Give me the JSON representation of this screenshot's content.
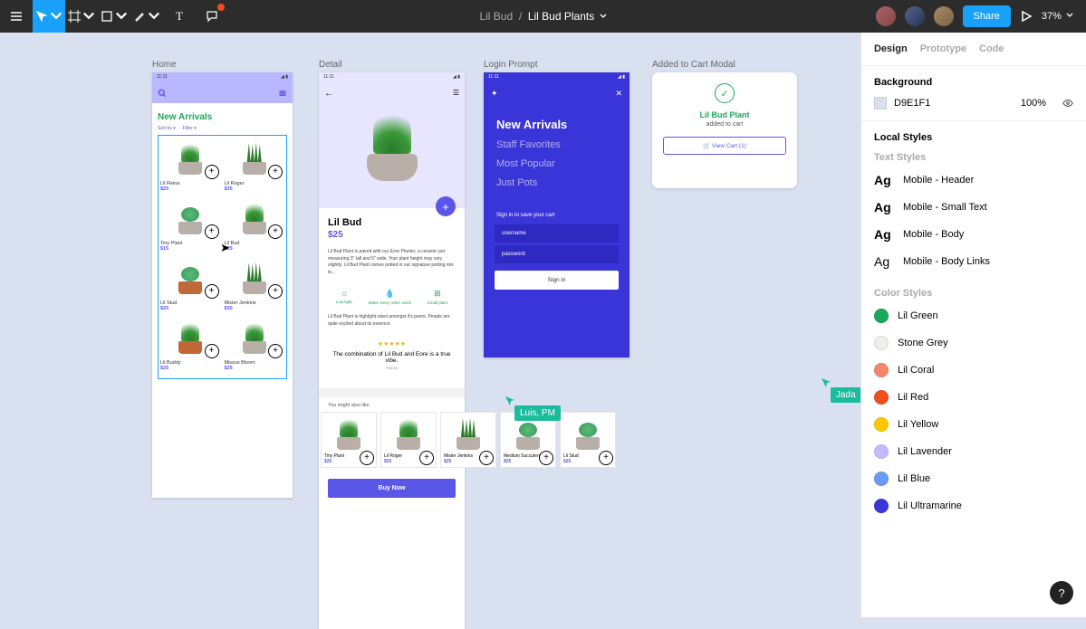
{
  "toolbar": {
    "title_prefix": "Lil Bud",
    "title": "Lil Bud Plants",
    "share_label": "Share",
    "zoom": "37%"
  },
  "frames": {
    "home": {
      "label": "Home",
      "time": "11:11",
      "section_title": "New Arrivals",
      "sort": "Sort by",
      "filter": "Filter",
      "products": [
        {
          "name": "Lil Reina",
          "price": "$25"
        },
        {
          "name": "Lil Roger",
          "price": "$35"
        },
        {
          "name": "Tiny Plant",
          "price": "$15"
        },
        {
          "name": "Lil Bud",
          "price": "$25"
        },
        {
          "name": "Lil Stud",
          "price": "$25"
        },
        {
          "name": "Mister Jenkins",
          "price": "$30"
        },
        {
          "name": "Lil Buddy",
          "price": "$25"
        },
        {
          "name": "Missus Bloom",
          "price": "$25"
        }
      ]
    },
    "detail": {
      "label": "Detail",
      "time": "11:11",
      "title": "Lil Bud",
      "price": "$25",
      "description": "Lil Bud Plant is paired with our Eore Planter, a ceramic pot measuring 3\" tall and 5\" wide. Your plant height may vary slightly. Lil Bud Plant comes potted in our signature potting mix to...",
      "stats": [
        {
          "icon": "☼",
          "label": "Low light"
        },
        {
          "icon": "💧",
          "label": "Water every other week"
        },
        {
          "icon": "⊞",
          "label": "Small plant"
        }
      ],
      "highlight": "Lil Bud Plant is highlight rated amongst it's peers. People are quite excited about its essence.",
      "stars": "★★★★★",
      "review": "The combination of Lil Bud and Eore is a true vibe.",
      "reviewer": "Tracey",
      "suggest_title": "You might also like",
      "suggestions": [
        {
          "name": "Tiny Plant",
          "price": "$25"
        },
        {
          "name": "Lil Roger",
          "price": "$25"
        },
        {
          "name": "Mister Jenkins",
          "price": "$25"
        },
        {
          "name": "Medium Succulent",
          "price": "$25"
        },
        {
          "name": "Lil Stud",
          "price": "$25"
        }
      ],
      "buy": "Buy Now"
    },
    "login": {
      "label": "Login Prompt",
      "time": "11:11",
      "nav": [
        "New Arrivals",
        "Staff Favorites",
        "Most Popular",
        "Just Pots"
      ],
      "form_label": "Sign in to save your cart",
      "username_ph": "username",
      "password_ph": "password",
      "signin": "Sign in"
    },
    "cart": {
      "label": "Added to Cart Modal",
      "title": "Lil Bud Plant",
      "sub": "added to cart",
      "btn": "🛒  View Cart (1)"
    }
  },
  "cursors": {
    "luis": "Luis, PM",
    "jada": "Jada"
  },
  "panel": {
    "tabs": [
      "Design",
      "Prototype",
      "Code"
    ],
    "background": {
      "title": "Background",
      "value": "D9E1F1",
      "opacity": "100%"
    },
    "local_styles": "Local Styles",
    "text_styles_label": "Text Styles",
    "text_styles": [
      "Mobile - Header",
      "Mobile - Small Text",
      "Mobile - Body",
      "Mobile - Body Links"
    ],
    "color_styles_label": "Color Styles",
    "colors": [
      {
        "name": "Lil Green",
        "hex": "#1aa75a"
      },
      {
        "name": "Stone Grey",
        "hex": "#f0eeec"
      },
      {
        "name": "Lil Coral",
        "hex": "#f48770"
      },
      {
        "name": "Lil Red",
        "hex": "#f24e1e"
      },
      {
        "name": "Lil Yellow",
        "hex": "#ffc700"
      },
      {
        "name": "Lil Lavender",
        "hex": "#c7b9ff"
      },
      {
        "name": "Lil Blue",
        "hex": "#699bf7"
      },
      {
        "name": "Lil Ultramarine",
        "hex": "#3a35d8"
      }
    ]
  }
}
